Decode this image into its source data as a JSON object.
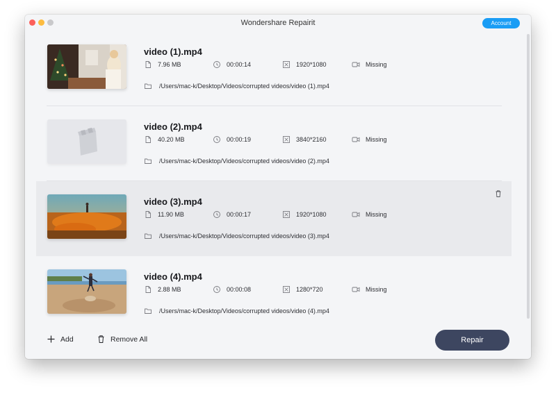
{
  "window": {
    "title": "Wondershare Repairit",
    "account_label": "Account"
  },
  "files": [
    {
      "name": "video (1).mp4",
      "size": "7.96 MB",
      "duration": "00:00:14",
      "resolution": "1920*1080",
      "audio_status": "Missing",
      "path": "/Users/mac-k/Desktop/Videos/corrupted videos/video (1).mp4",
      "thumbnail": "christmas-room-scene"
    },
    {
      "name": "video (2).mp4",
      "size": "40.20 MB",
      "duration": "00:00:19",
      "resolution": "3840*2160",
      "audio_status": "Missing",
      "path": "/Users/mac-k/Desktop/Videos/corrupted videos/video (2).mp4",
      "thumbnail": "clapperboard-placeholder"
    },
    {
      "name": "video (3).mp4",
      "size": "11.90 MB",
      "duration": "00:00:17",
      "resolution": "1920*1080",
      "audio_status": "Missing",
      "path": "/Users/mac-k/Desktop/Videos/corrupted videos/video (3).mp4",
      "thumbnail": "orange-flower-field"
    },
    {
      "name": "video (4).mp4",
      "size": "2.88 MB",
      "duration": "00:00:08",
      "resolution": "1280*720",
      "audio_status": "Missing",
      "path": "/Users/mac-k/Desktop/Videos/corrupted videos/video (4).mp4",
      "thumbnail": "beach-runner"
    }
  ],
  "footer": {
    "add_label": "Add",
    "remove_all_label": "Remove All",
    "repair_label": "Repair"
  },
  "colors": {
    "accent": "#1a9df5",
    "repair_button": "#3d4660",
    "selected_row": "#e9eaed",
    "background": "#f4f5f7"
  },
  "icons": {
    "size": "file-icon",
    "duration": "clock-icon",
    "resolution": "expand-icon",
    "audio": "video-camera-icon",
    "path": "folder-icon",
    "delete": "trash-icon",
    "add": "plus-icon",
    "remove": "trash-icon"
  }
}
